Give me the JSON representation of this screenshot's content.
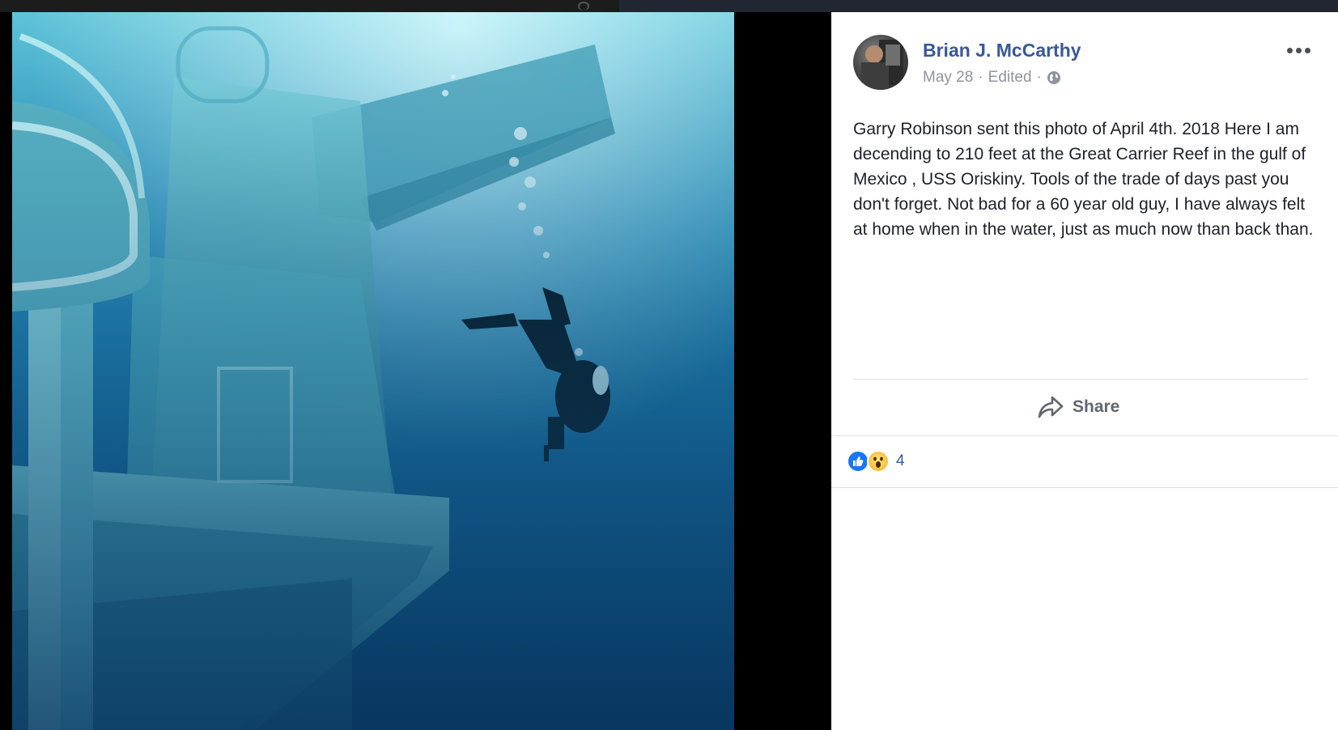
{
  "post": {
    "author": "Brian J. McCarthy",
    "date": "May 28",
    "edited": "Edited",
    "separator": "·",
    "text": "Garry Robinson sent this photo of April 4th. 2018 Here I am decending to 210 feet at the Great Carrier Reef in the gulf of Mexico , USS Oriskiny. Tools of the trade of days past you don't forget. Not bad for a 60 year old guy, I have always felt at home when in the water, just as much now than back than.",
    "share_label": "Share",
    "reaction_count": "4"
  },
  "colors": {
    "author_link": "#385898",
    "meta_text": "#90949c",
    "panel_bg": "#ffffff",
    "like_blue": "#1877f2"
  },
  "icons": {
    "more": "more-options-icon",
    "privacy": "globe-icon",
    "share": "share-arrow-icon",
    "reactions": [
      "like-icon",
      "wow-icon"
    ]
  }
}
